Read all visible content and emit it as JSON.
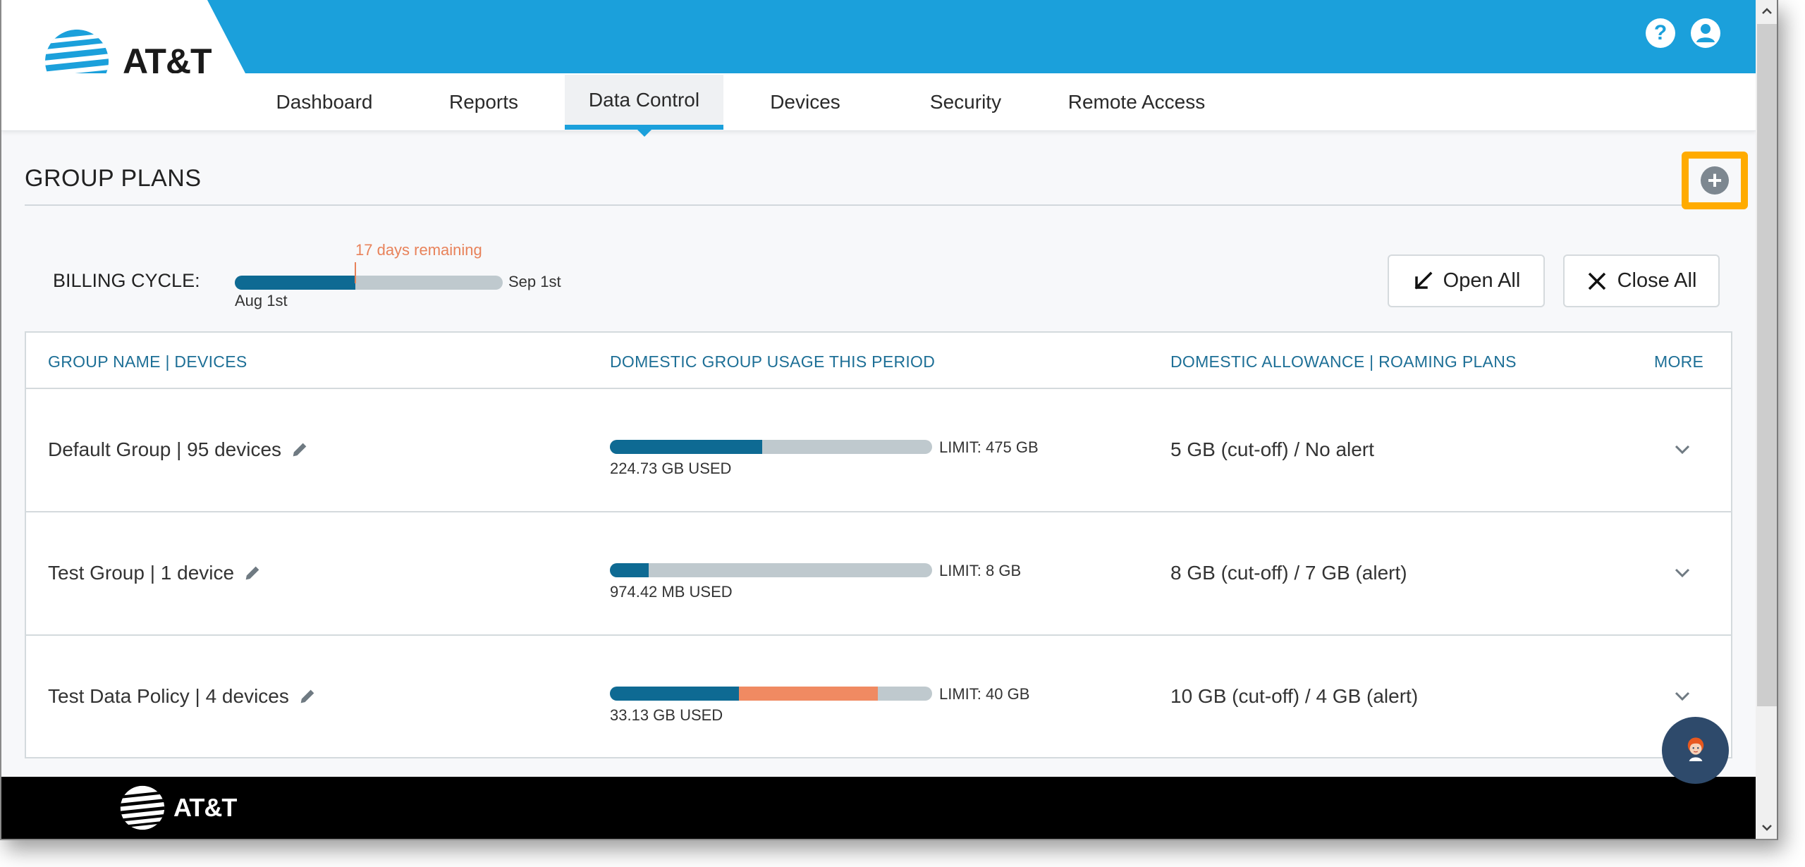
{
  "brand": {
    "name": "AT&T",
    "colors": {
      "header_blue": "#1ba0db",
      "usage_blue": "#0e6a93",
      "usage_alert": "#f08a62",
      "track_gray": "#bfc9ce",
      "highlight": "#ffab00",
      "column_header": "#1d6f96"
    }
  },
  "header": {
    "icons": [
      "help-icon",
      "user-profile-icon"
    ],
    "help_glyph": "?"
  },
  "nav": {
    "items": [
      {
        "label": "Dashboard"
      },
      {
        "label": "Reports"
      },
      {
        "label": "Data Control",
        "active": true
      },
      {
        "label": "Devices"
      },
      {
        "label": "Security"
      },
      {
        "label": "Remote Access"
      }
    ]
  },
  "section": {
    "title": "GROUP PLANS",
    "add_icon": "plus-circle-icon"
  },
  "billing": {
    "label": "BILLING CYCLE:",
    "start": "Aug 1st",
    "end": "Sep 1st",
    "remaining": "17 days remaining",
    "elapsed_fraction": 0.45
  },
  "actions": {
    "open_all": "Open All",
    "close_all": "Close All"
  },
  "table": {
    "columns": [
      "GROUP NAME | DEVICES",
      "DOMESTIC GROUP USAGE THIS PERIOD",
      "DOMESTIC ALLOWANCE | ROAMING PLANS",
      "MORE"
    ],
    "rows": [
      {
        "name": "Default Group | 95 devices",
        "used": "224.73 GB USED",
        "limit": "LIMIT: 475 GB",
        "used_fraction": 0.473,
        "alert_fraction": 0,
        "allowance": "5 GB (cut-off) / No alert"
      },
      {
        "name": "Test Group | 1 device",
        "used": "974.42 MB USED",
        "limit": "LIMIT: 8 GB",
        "used_fraction": 0.12,
        "alert_fraction": 0,
        "allowance": "8 GB (cut-off) / 7 GB (alert)"
      },
      {
        "name": "Test Data Policy | 4 devices",
        "used": "33.13 GB USED",
        "limit": "LIMIT: 40 GB",
        "used_fraction": 0.4,
        "alert_fraction": 0.43,
        "allowance": "10 GB (cut-off) / 4 GB (alert)"
      }
    ]
  },
  "chat": {
    "icon": "chat-assistant-avatar-icon"
  },
  "footer": {
    "brand": "AT&T"
  }
}
